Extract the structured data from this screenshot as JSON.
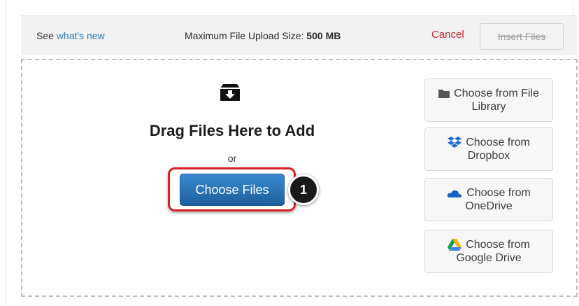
{
  "header": {
    "see_prefix": "See",
    "whats_new_link": "what's new",
    "max_size_label": "Maximum File Upload Size:",
    "max_size_value": "500 MB",
    "cancel_label": "Cancel",
    "insert_label": "Insert Files"
  },
  "dropzone": {
    "title": "Drag Files Here to Add",
    "or_text": "or",
    "choose_files_label": "Choose Files",
    "step_number": "1"
  },
  "sources": [
    {
      "icon": "folder-icon",
      "line1": "Choose from File",
      "line2": "Library"
    },
    {
      "icon": "dropbox-icon",
      "line1": "Choose from",
      "line2": "Dropbox"
    },
    {
      "icon": "onedrive-icon",
      "line1": "Choose from",
      "line2": "OneDrive"
    },
    {
      "icon": "google-drive-icon",
      "line1": "Choose from",
      "line2": "Google Drive"
    }
  ],
  "colors": {
    "link": "#2a7ab8",
    "cancel": "#c4262e",
    "primary_button": "#2a72b5",
    "highlight": "#d72027"
  }
}
